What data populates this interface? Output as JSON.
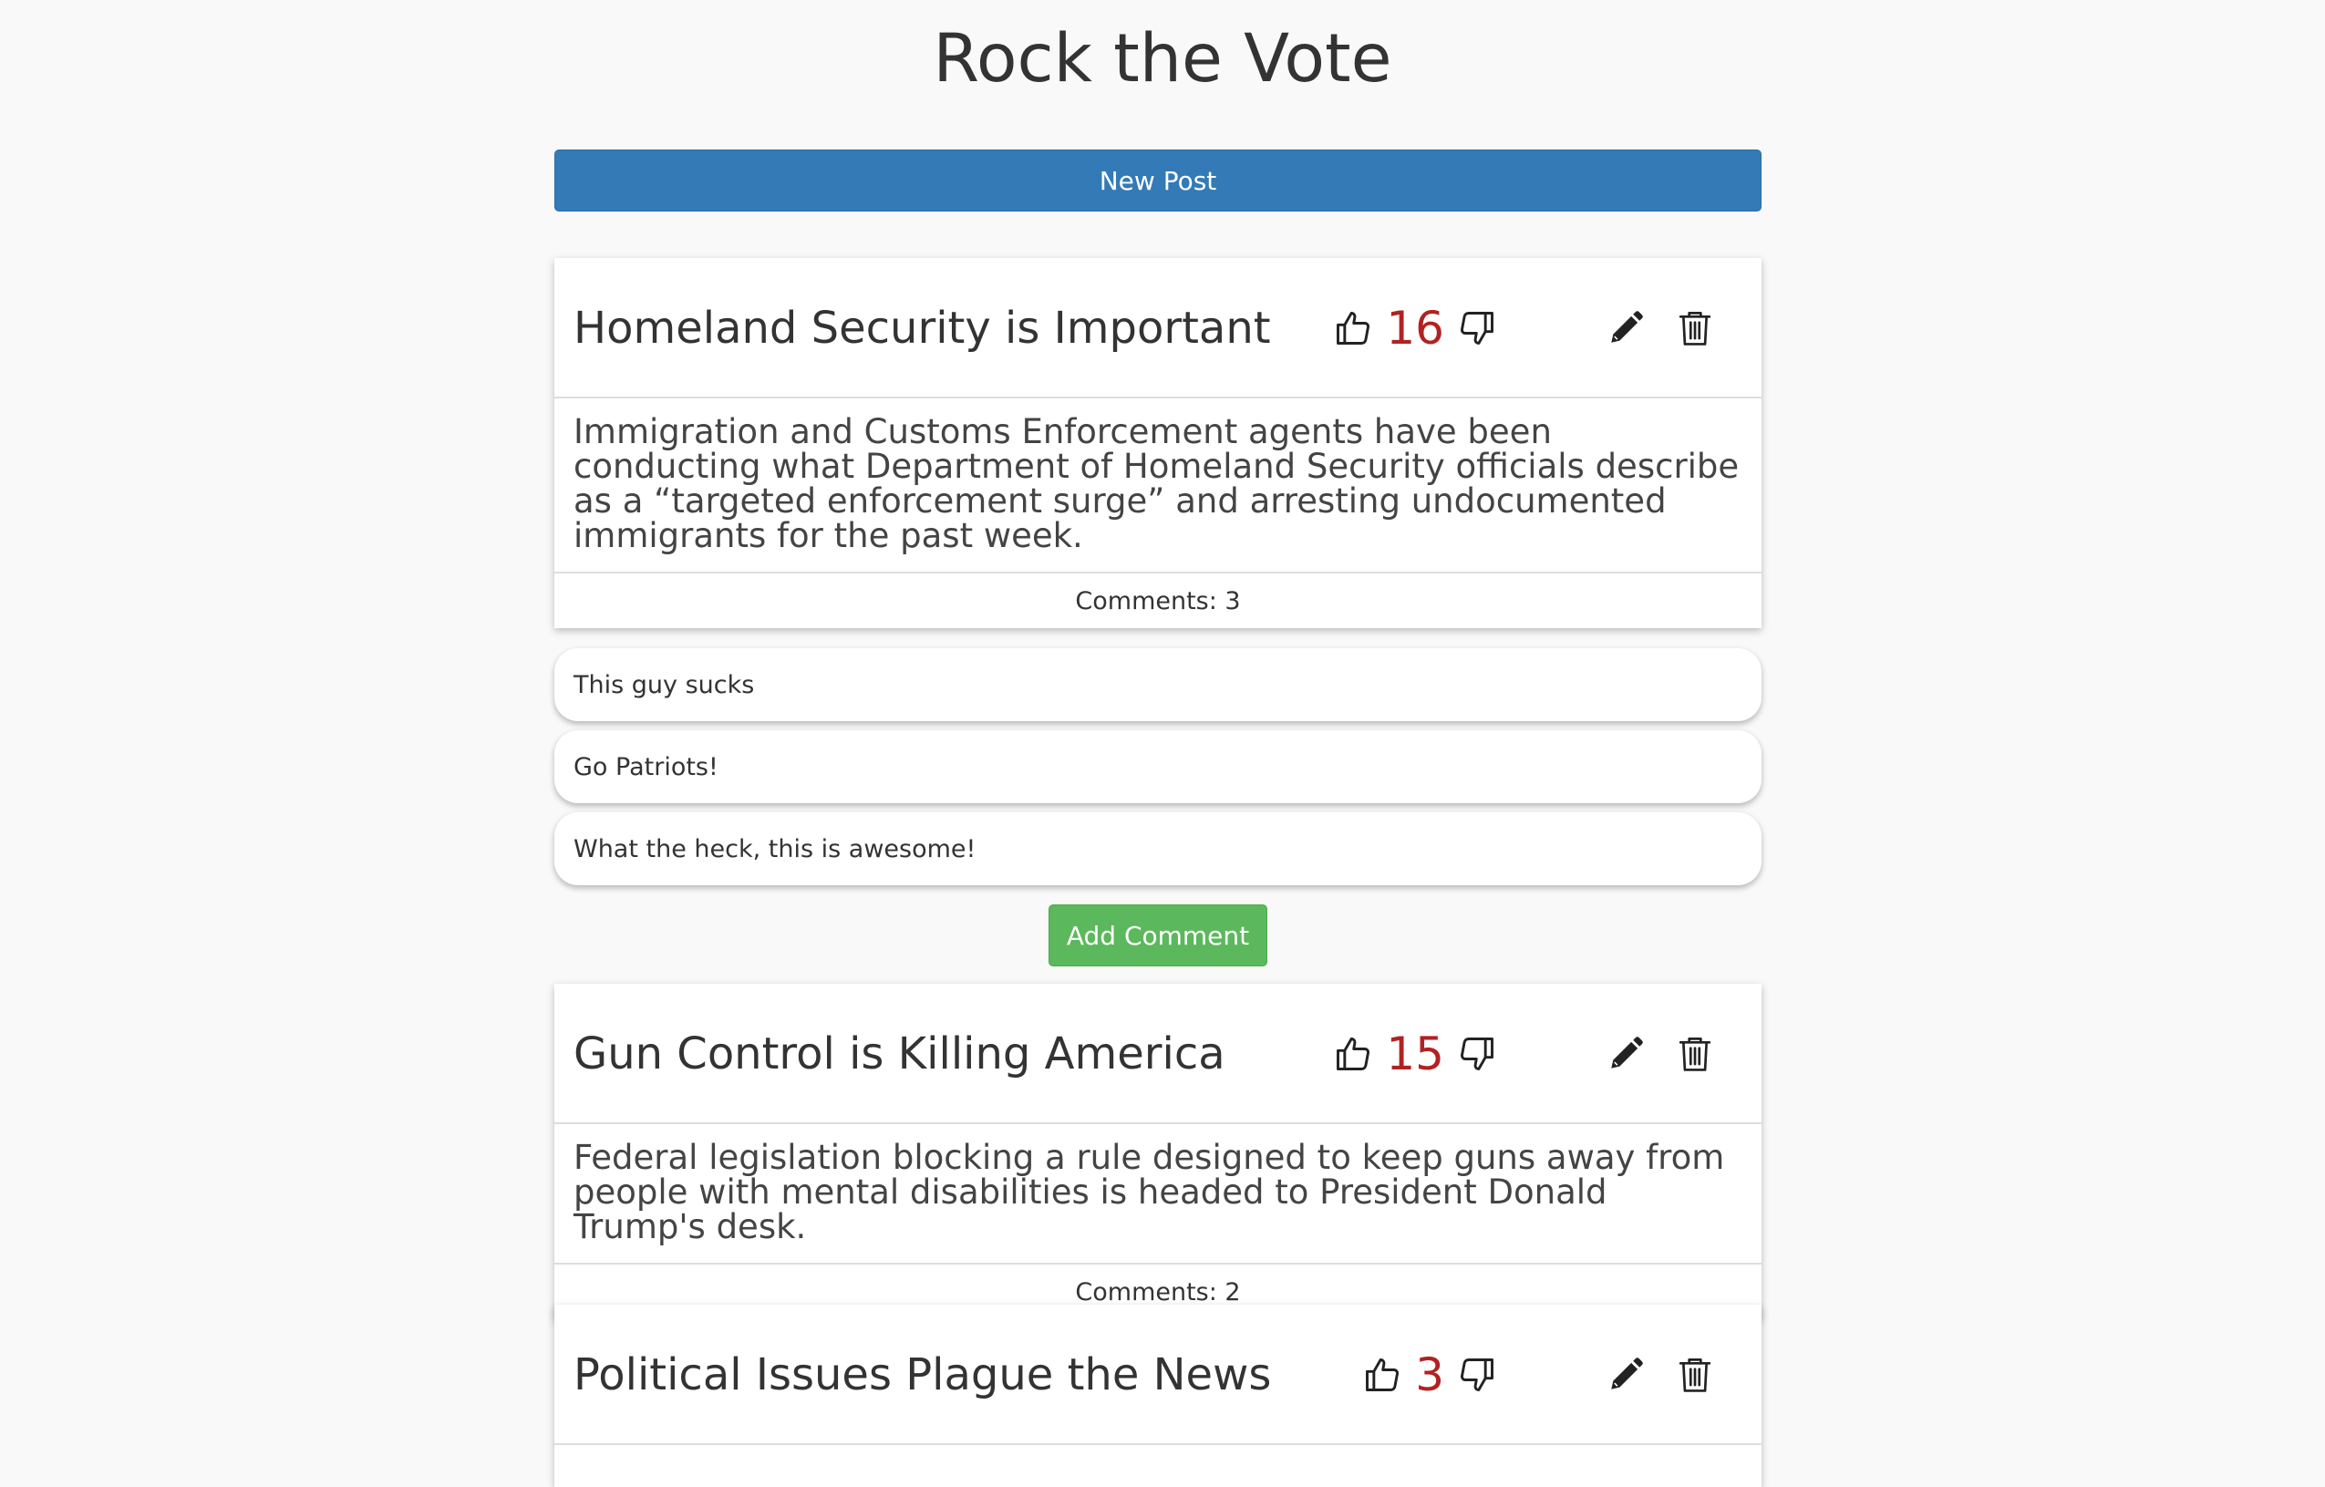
{
  "app": {
    "title": "Rock the Vote",
    "new_post_label": "New Post",
    "add_comment_label": "Add Comment"
  },
  "colors": {
    "primary": "#337ab7",
    "success": "#5cb85c",
    "vote_count": "#b22222",
    "background": "#f9f9f9"
  },
  "icons": {
    "upvote": "thumbs-up-icon",
    "downvote": "thumbs-down-icon",
    "edit": "pencil-icon",
    "delete": "trash-icon"
  },
  "posts": [
    {
      "title": "Homeland Security is Important",
      "votes": "16",
      "body": "Immigration and Customs Enforcement agents have been conducting what Department of Homeland Security officials describe as a “targeted enforcement surge” and arresting undocumented immigrants for the past week.",
      "comments_label": "Comments: 3",
      "comments": [
        "This guy sucks",
        "Go Patriots!",
        "What the heck, this is awesome!"
      ]
    },
    {
      "title": "Gun Control is Killing America",
      "votes": "15",
      "body": "Federal legislation blocking a rule designed to keep guns away from people with mental disabilities is headed to President Donald Trump's desk.",
      "comments_label": "Comments: 2"
    },
    {
      "title": "Political Issues Plague the News",
      "votes": "3"
    }
  ]
}
